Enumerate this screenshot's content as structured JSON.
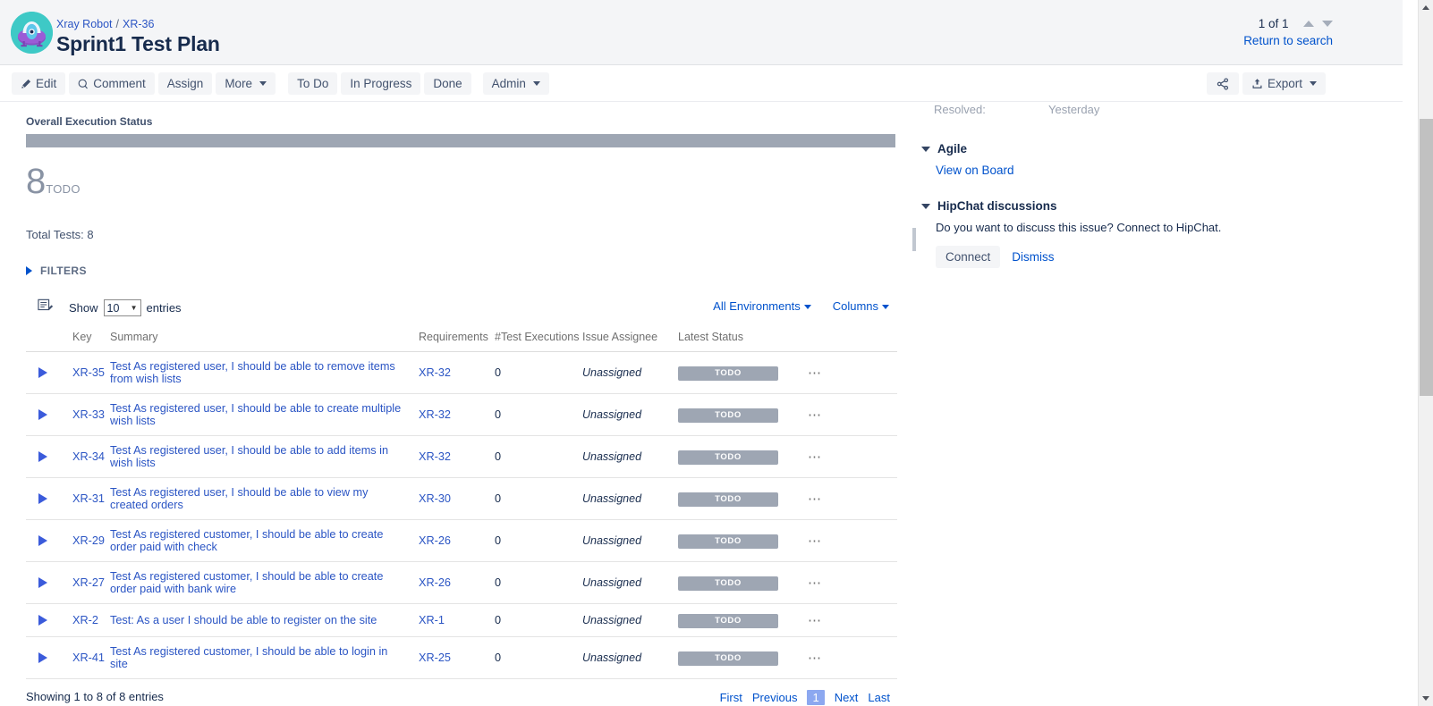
{
  "header": {
    "breadcrumb_project": "Xray Robot",
    "breadcrumb_sep": "/",
    "breadcrumb_issue": "XR-36",
    "title": "Sprint1 Test Plan",
    "nav_count": "1 of 1",
    "return_to_search": "Return to search"
  },
  "toolbar": {
    "edit": "Edit",
    "comment": "Comment",
    "assign": "Assign",
    "more": "More",
    "todo": "To Do",
    "in_progress": "In Progress",
    "done": "Done",
    "admin": "Admin",
    "share_icon": "share-icon",
    "export": "Export"
  },
  "xray": {
    "section_label": "Overall Execution Status",
    "progress": [
      {
        "status": "TODO",
        "percent": 100,
        "color": "#9ea6b3"
      }
    ],
    "summary_count": "8",
    "summary_status": "TODO",
    "total_tests": "Total Tests: 8",
    "filters_label": "FILTERS"
  },
  "table_controls": {
    "show_label": "Show",
    "entries_value": "10",
    "entries_label": "entries",
    "environments": "All Environments",
    "columns": "Columns"
  },
  "table": {
    "columns": [
      "",
      "Key",
      "Summary",
      "Requirements",
      "#Test Executions",
      "Issue Assignee",
      "Latest Status",
      ""
    ],
    "rows": [
      {
        "key": "XR-35",
        "summary": "Test As registered user, I should be able to remove items from wish lists",
        "requirement": "XR-32",
        "executions": "0",
        "assignee": "Unassigned",
        "status": "TODO"
      },
      {
        "key": "XR-33",
        "summary": "Test As registered user, I should be able to create multiple wish lists",
        "requirement": "XR-32",
        "executions": "0",
        "assignee": "Unassigned",
        "status": "TODO"
      },
      {
        "key": "XR-34",
        "summary": "Test As registered user, I should be able to add items in wish lists",
        "requirement": "XR-32",
        "executions": "0",
        "assignee": "Unassigned",
        "status": "TODO"
      },
      {
        "key": "XR-31",
        "summary": "Test As registered user, I should be able to view my created orders",
        "requirement": "XR-30",
        "executions": "0",
        "assignee": "Unassigned",
        "status": "TODO"
      },
      {
        "key": "XR-29",
        "summary": "Test As registered customer, I should be able to create order paid with check",
        "requirement": "XR-26",
        "executions": "0",
        "assignee": "Unassigned",
        "status": "TODO"
      },
      {
        "key": "XR-27",
        "summary": "Test As registered customer, I should be able to create order paid with bank wire",
        "requirement": "XR-26",
        "executions": "0",
        "assignee": "Unassigned",
        "status": "TODO"
      },
      {
        "key": "XR-2",
        "summary": "Test: As a user I should be able to register on the site",
        "requirement": "XR-1",
        "executions": "0",
        "assignee": "Unassigned",
        "status": "TODO"
      },
      {
        "key": "XR-41",
        "summary": "Test As registered customer, I should be able to login in site",
        "requirement": "XR-25",
        "executions": "0",
        "assignee": "Unassigned",
        "status": "TODO"
      }
    ],
    "footer_showing": "Showing 1 to 8 of 8 entries",
    "pager": {
      "first": "First",
      "previous": "Previous",
      "current": "1",
      "next": "Next",
      "last": "Last"
    }
  },
  "sidebar": {
    "resolved_label": "Resolved:",
    "resolved_value": "Yesterday",
    "agile": {
      "title": "Agile",
      "link": "View on Board"
    },
    "hipchat": {
      "title": "HipChat discussions",
      "text": "Do you want to discuss this issue? Connect to HipChat.",
      "connect": "Connect",
      "dismiss": "Dismiss"
    }
  }
}
